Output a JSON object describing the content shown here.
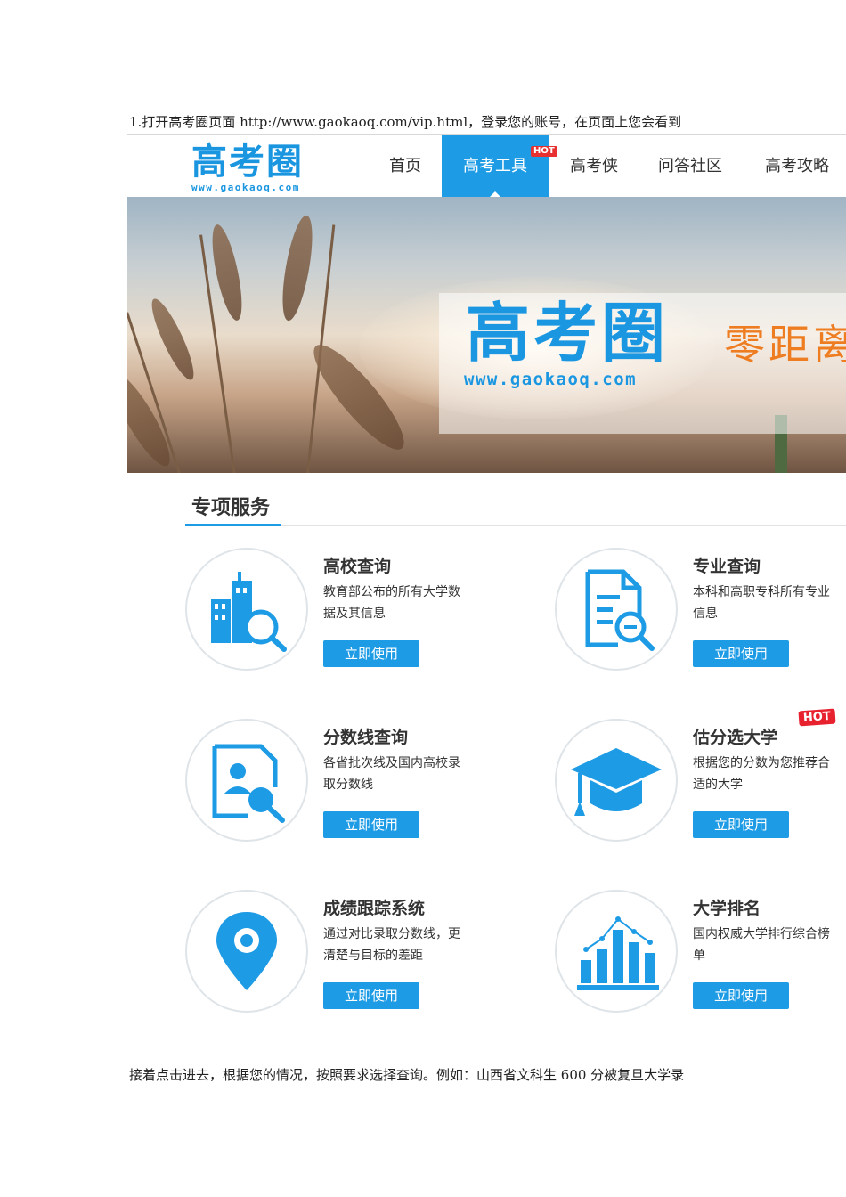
{
  "document": {
    "intro": "1.打开高考圈页面 http://www.gaokaoq.com/vip.html，登录您的账号，在页面上您会看到",
    "outro": "接着点击进去，根据您的情况，按照要求选择查询。例如：山西省文科生 600 分被复旦大学录"
  },
  "nav": {
    "logo_text": "高考圈",
    "logo_url": "www.gaokaoq.com",
    "items": [
      {
        "label": "首页"
      },
      {
        "label": "高考工具",
        "badge": "HOT",
        "active": true
      },
      {
        "label": "高考侠"
      },
      {
        "label": "问答社区"
      },
      {
        "label": "高考攻略"
      }
    ]
  },
  "banner": {
    "title": "高考圈",
    "url": "www.gaokaoq.com",
    "slogan": "零距离"
  },
  "services": {
    "title": "专项服务",
    "cards": [
      {
        "title": "高校查询",
        "desc": "教育部公布的所有大学数据及其信息",
        "button": "立即使用",
        "icon": "building-search-icon"
      },
      {
        "title": "专业查询",
        "desc": "本科和高职专科所有专业信息",
        "button": "立即使用",
        "icon": "document-search-icon"
      },
      {
        "title": "分数线查询",
        "desc": "各省批次线及国内高校录取分数线",
        "button": "立即使用",
        "icon": "profile-search-icon"
      },
      {
        "title": "估分选大学",
        "desc": "根据您的分数为您推荐合适的大学",
        "button": "立即使用",
        "icon": "graduation-cap-icon",
        "badge": "HOT"
      },
      {
        "title": "成绩跟踪系统",
        "desc": "通过对比录取分数线，更清楚与目标的差距",
        "button": "立即使用",
        "icon": "map-pin-icon"
      },
      {
        "title": "大学排名",
        "desc": "国内权威大学排行综合榜单",
        "button": "立即使用",
        "icon": "bar-chart-icon"
      }
    ]
  },
  "colors": {
    "accent": "#1e9be5",
    "hot": "#e8212f",
    "slogan": "#ee7d22"
  }
}
